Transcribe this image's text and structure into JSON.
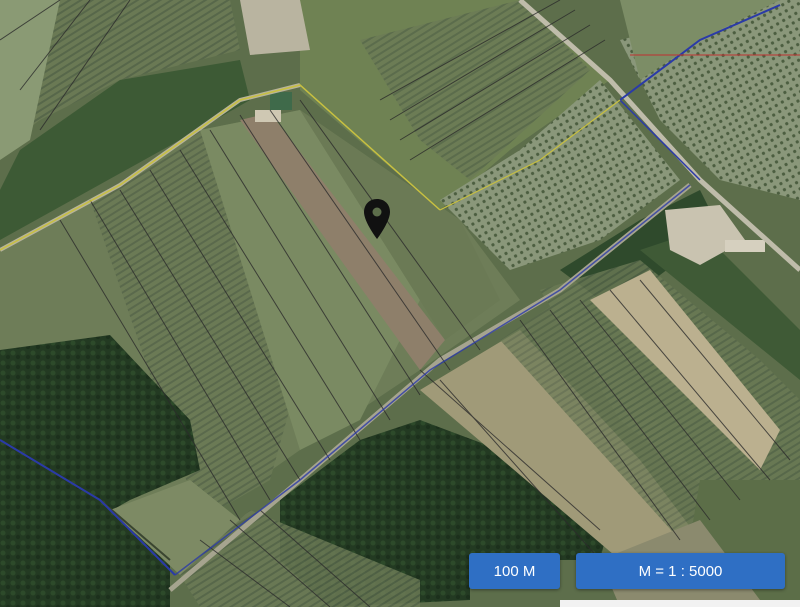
{
  "map": {
    "type": "satellite cadastral map",
    "marker_icon": "location-pin-icon"
  },
  "controls": {
    "scale_label": "100 M",
    "ratio_label": "M = 1 : 5000"
  },
  "colors": {
    "button_bg": "#2f6fc4",
    "button_text": "#ffffff",
    "parcel_line": "#2b2b2b",
    "boundary_blue": "#2a3aa8",
    "boundary_yellow": "#c8c040",
    "boundary_red": "#c03030"
  }
}
